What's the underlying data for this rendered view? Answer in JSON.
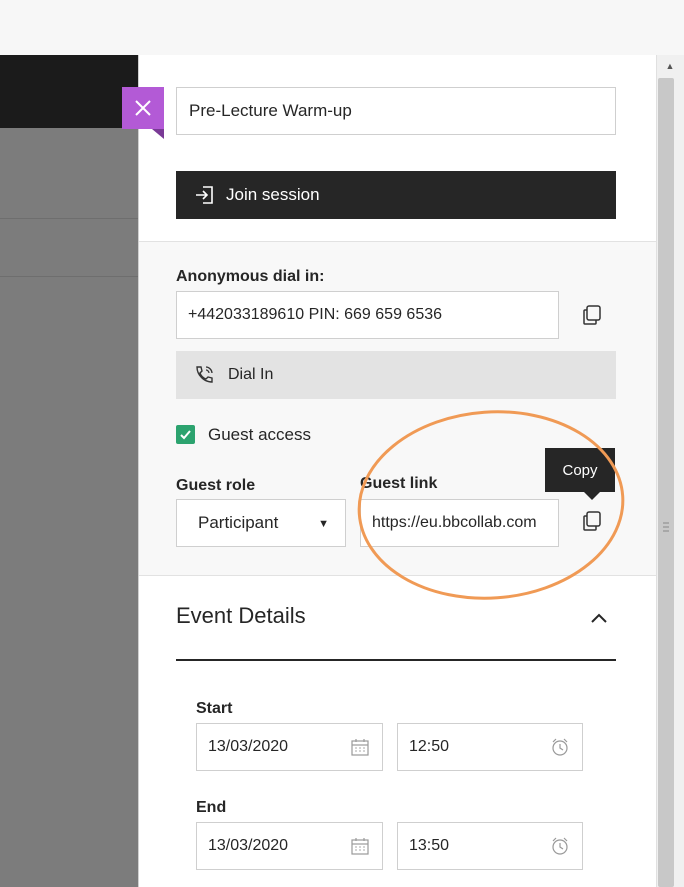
{
  "session": {
    "title": "Pre-Lecture Warm-up",
    "join_label": "Join session"
  },
  "dial": {
    "heading": "Anonymous dial in:",
    "number": "+442033189610 PIN: 669 659 6536",
    "button_label": "Dial In"
  },
  "guest": {
    "access_label": "Guest access",
    "access_checked": true,
    "role_heading": "Guest role",
    "role_value": "Participant",
    "link_heading": "Guest link",
    "link_value": "https://eu.bbcollab.com",
    "copy_tooltip": "Copy"
  },
  "event": {
    "heading": "Event Details",
    "start_label": "Start",
    "start_date": "13/03/2020",
    "start_time": "12:50",
    "end_label": "End",
    "end_date": "13/03/2020",
    "end_time": "13:50"
  },
  "colors": {
    "close_accent": "#b35ad6",
    "checkbox": "#2ca36f",
    "highlight": "#f09a55"
  },
  "icons": {
    "close": "close-icon",
    "join": "enter-icon",
    "copy": "copy-icon",
    "phone": "phone-icon",
    "calendar": "calendar-icon",
    "clock": "clock-icon",
    "collapse": "chevron-up-icon"
  }
}
